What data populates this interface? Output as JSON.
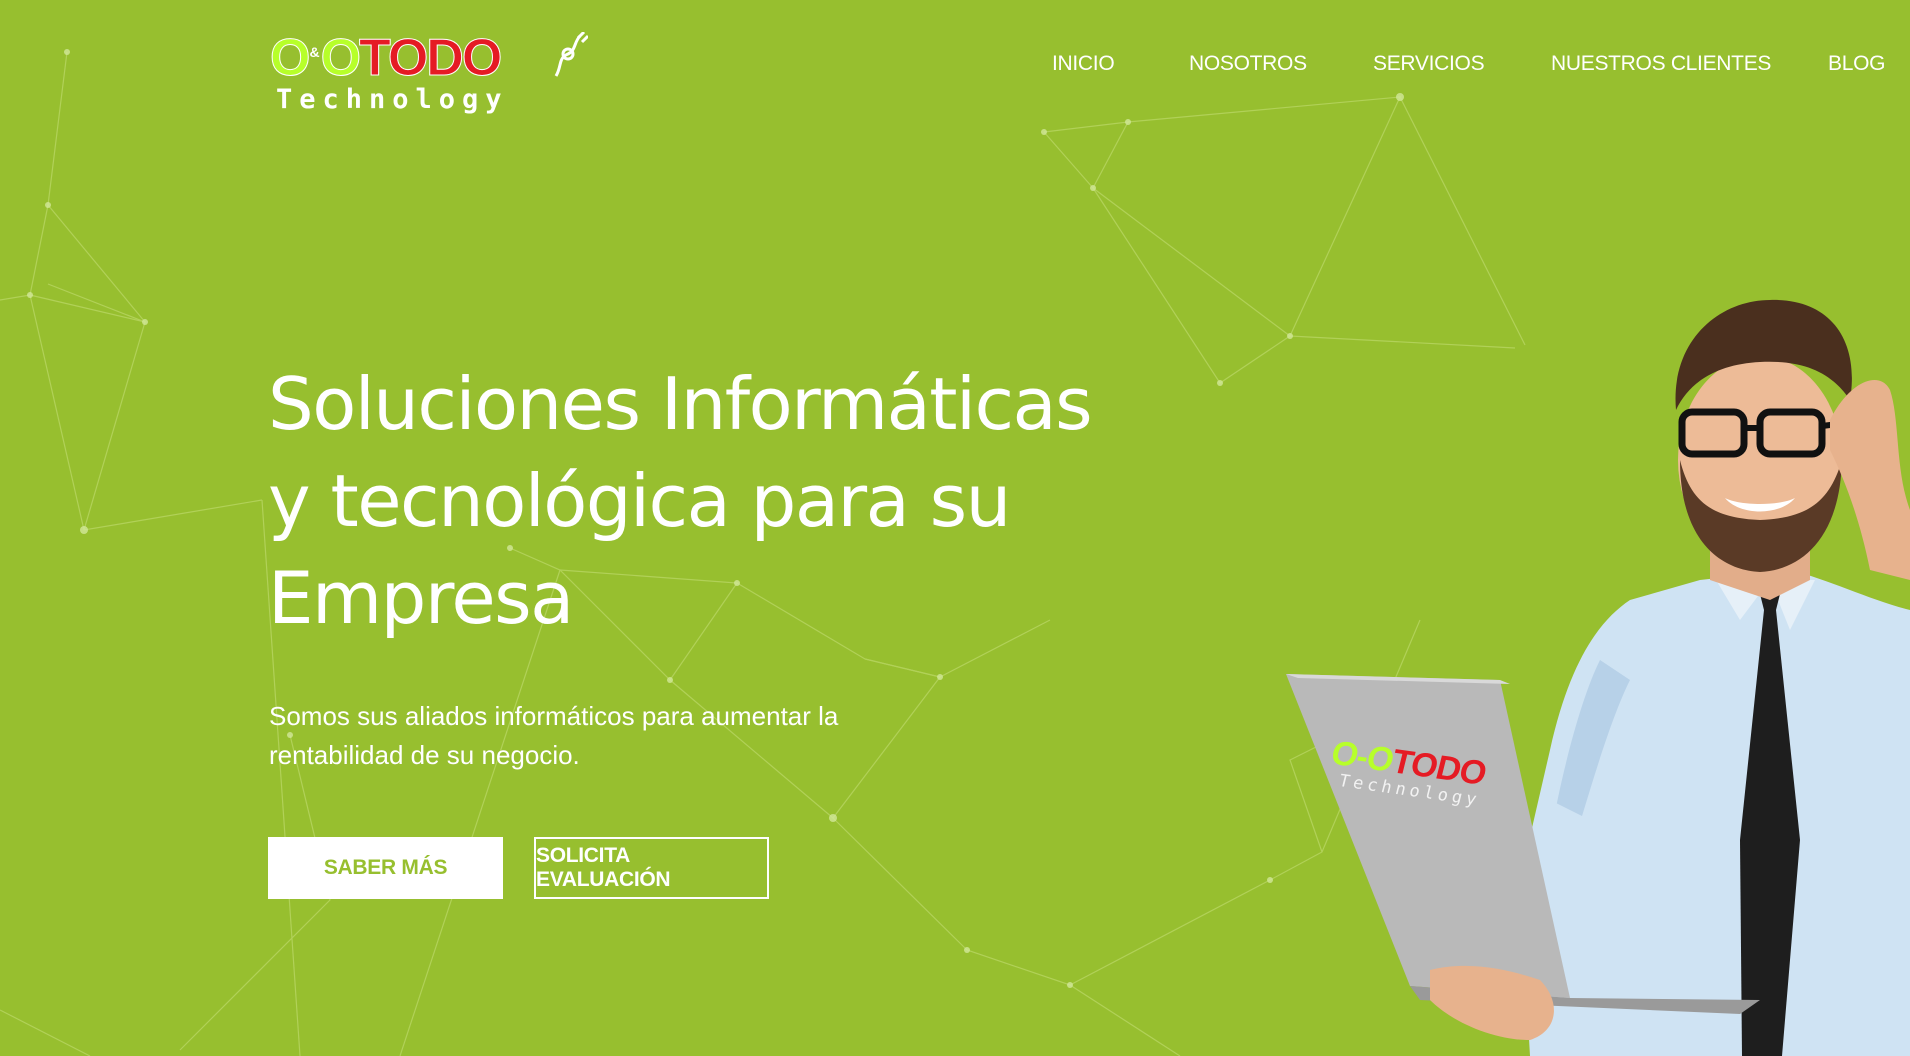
{
  "brand": {
    "logo_oo": "O&O",
    "logo_oo_left": "O",
    "logo_amp": "&",
    "logo_oo_right": "O",
    "logo_todo": "TODO",
    "logo_tagline": "Technology",
    "colors": {
      "green": "#b7ff2a",
      "red": "#e51b24"
    }
  },
  "nav": {
    "items": [
      {
        "label": "INICIO"
      },
      {
        "label": "NOSOTROS"
      },
      {
        "label": "SERVICIOS"
      },
      {
        "label": "NUESTROS CLIENTES"
      },
      {
        "label": "BLOG"
      }
    ]
  },
  "hero": {
    "title_line1": "Soluciones Informáticas",
    "title_line2": "y tecnológica para su",
    "title_line3": "Empresa",
    "subtitle_line1": "Somos sus aliados informáticos para aumentar la",
    "subtitle_line2": "rentabilidad de su negocio.",
    "primary_button": "SABER MÁS",
    "secondary_button": "SOLICITA EVALUACIÓN"
  },
  "laptop_logo": {
    "oo": "O-O",
    "todo": "TODO",
    "tagline": "Technology"
  },
  "theme": {
    "background": "#97bf2f",
    "text": "#ffffff"
  }
}
